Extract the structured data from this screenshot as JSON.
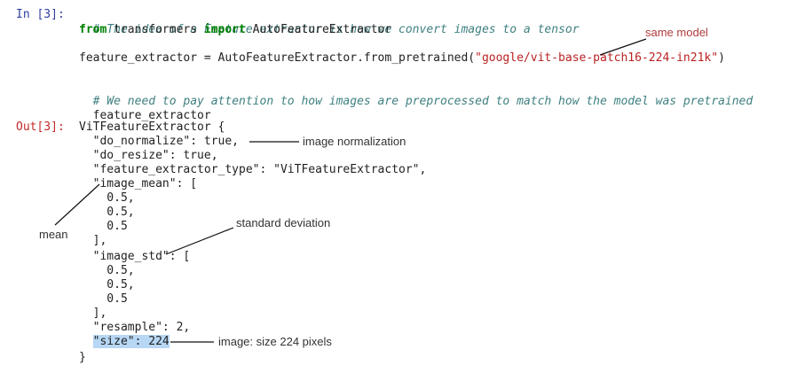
{
  "cell_in": {
    "prompt": "In [3]:",
    "lines": [
      {
        "comment": "# The idea of a Feature extractor is how we convert images to a tensor"
      },
      {
        "kw1": "from",
        "mid": " transformers ",
        "kw2": "import",
        "rest": " AutoFeatureExtractor"
      },
      {
        "pre": "feature_extractor = AutoFeatureExtractor.from_pretrained(",
        "str": "\"google/vit-base-patch16-224-in21k\"",
        "post": ")"
      },
      {
        "comment": "# We need to pay attention to how images are preprocessed to match how the model was pretrained"
      },
      {
        "text": "feature_extractor"
      }
    ]
  },
  "cell_out": {
    "prompt": "Out[3]:",
    "lines": [
      "ViTFeatureExtractor {",
      "  \"do_normalize\": true,",
      "  \"do_resize\": true,",
      "  \"feature_extractor_type\": \"ViTFeatureExtractor\",",
      "  \"image_mean\": [",
      "    0.5,",
      "    0.5,",
      "    0.5",
      "  ],",
      "  \"image_std\": [",
      "    0.5,",
      "    0.5,",
      "    0.5",
      "  ],",
      "  \"resample\": 2,",
      "  ",
      "}"
    ],
    "size_line_highlight": "\"size\": 224"
  },
  "annotations": {
    "same_model": "same model",
    "image_normalization": "image normalization",
    "mean": "mean",
    "standard_deviation": "standard deviation",
    "image_size": "image: size 224 pixels"
  },
  "colors": {
    "in_prompt": "#303f9f",
    "out_prompt": "#c62828",
    "comment": "#408080",
    "keyword": "#008000",
    "string": "#ba2121",
    "highlight": "#b7d7f5"
  }
}
